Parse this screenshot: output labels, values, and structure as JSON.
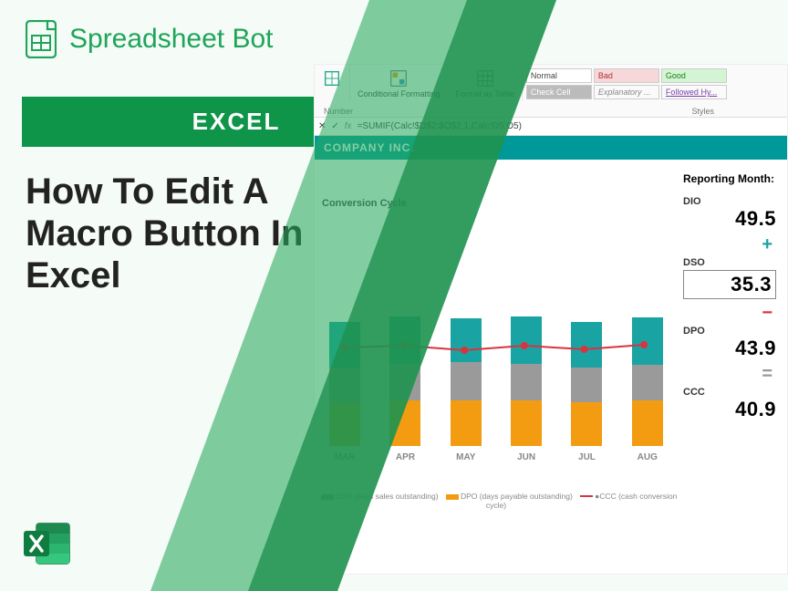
{
  "brand": "Spreadsheet Bot",
  "badge": "EXCEL",
  "title": "How To Edit A Macro Button In Excel",
  "ribbon": {
    "number_group": "Number",
    "cond_fmt": "Conditional Formatting",
    "fmt_table": "Format as Table",
    "styles_label": "Styles",
    "cells": {
      "normal": "Normal",
      "bad": "Bad",
      "good": "Good",
      "check": "Check Cell",
      "explan": "Explanatory ...",
      "followed": "Followed Hy..."
    }
  },
  "formula": "=SUMIF(Calc!$D$2:$O$2,1,Calc!D5:O5)",
  "company": "COMPANY INC.",
  "reporting": "Reporting Month:",
  "chart_title": "Conversion Cycle",
  "chart_data": {
    "type": "bar",
    "categories": [
      "MAR",
      "APR",
      "MAY",
      "JUN",
      "JUL",
      "AUG"
    ],
    "series": [
      {
        "name": "DIO",
        "values": [
          48,
          50,
          46,
          50,
          48,
          49.5
        ]
      },
      {
        "name": "DSO (days sales outstanding)",
        "values": [
          34,
          36,
          38,
          36,
          34,
          35.3
        ]
      },
      {
        "name": "DPO (days payable outstanding)",
        "values": [
          42,
          44,
          44,
          44,
          42,
          43.9
        ]
      },
      {
        "name": "CCC (cash conversion cycle)",
        "values": [
          40,
          42,
          40,
          42,
          40,
          40.9
        ]
      }
    ],
    "ylim": [
      0,
      140
    ]
  },
  "legend": {
    "dso": "DSO (days sales outstanding)",
    "dpo": "DPO (days payable outstanding)",
    "ccc": "CCC (cash conversion cycle)"
  },
  "metrics": {
    "dio_lbl": "DIO",
    "dio": "49.5",
    "dso_lbl": "DSO",
    "dso": "35.3",
    "dpo_lbl": "DPO",
    "dpo": "43.9",
    "ccc_lbl": "CCC",
    "ccc": "40.9"
  }
}
